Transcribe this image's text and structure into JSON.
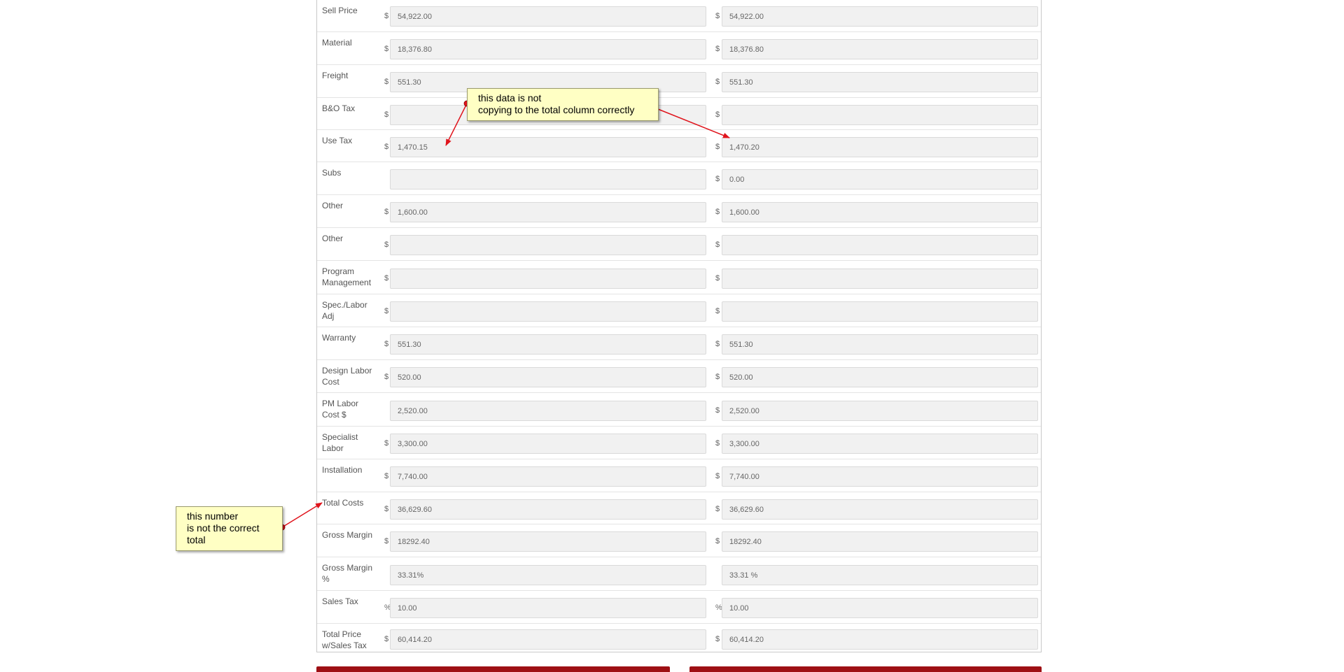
{
  "rows": [
    {
      "label": "Sell Price",
      "cur_a": "$",
      "val_a": "54,922.00",
      "cur_b": "$",
      "val_b": "54,922.00"
    },
    {
      "label": "Material",
      "cur_a": "$",
      "val_a": "18,376.80",
      "cur_b": "$",
      "val_b": "18,376.80"
    },
    {
      "label": "Freight",
      "cur_a": "$",
      "val_a": "551.30",
      "cur_b": "$",
      "val_b": "551.30"
    },
    {
      "label": "B&O Tax",
      "cur_a": "$",
      "val_a": "",
      "cur_b": "$",
      "val_b": ""
    },
    {
      "label": "Use Tax",
      "cur_a": "$",
      "val_a": "1,470.15",
      "cur_b": "$",
      "val_b": "1,470.20"
    },
    {
      "label": "Subs",
      "cur_a": "",
      "val_a": "",
      "cur_b": "$",
      "val_b": "0.00"
    },
    {
      "label": "Other",
      "cur_a": "$",
      "val_a": "1,600.00",
      "cur_b": "$",
      "val_b": "1,600.00"
    },
    {
      "label": "Other",
      "cur_a": "$",
      "val_a": "",
      "cur_b": "$",
      "val_b": ""
    },
    {
      "label": "Program Management",
      "cur_a": "$",
      "val_a": "",
      "cur_b": "$",
      "val_b": ""
    },
    {
      "label": "Spec./Labor Adj",
      "cur_a": "$",
      "val_a": "",
      "cur_b": "$",
      "val_b": ""
    },
    {
      "label": "Warranty",
      "cur_a": "$",
      "val_a": "551.30",
      "cur_b": "$",
      "val_b": "551.30"
    },
    {
      "label": "Design Labor Cost",
      "cur_a": "$",
      "val_a": "520.00",
      "cur_b": "$",
      "val_b": "520.00"
    },
    {
      "label": "PM Labor Cost $",
      "cur_a": "",
      "val_a": "2,520.00",
      "cur_b": "$",
      "val_b": "2,520.00"
    },
    {
      "label": "Specialist Labor",
      "cur_a": "$",
      "val_a": "3,300.00",
      "cur_b": "$",
      "val_b": "3,300.00"
    },
    {
      "label": "Installation",
      "cur_a": "$",
      "val_a": "7,740.00",
      "cur_b": "$",
      "val_b": "7,740.00"
    },
    {
      "label": "Total Costs",
      "cur_a": "$",
      "val_a": "36,629.60",
      "cur_b": "$",
      "val_b": "36,629.60"
    },
    {
      "label": "Gross Margin",
      "cur_a": "$",
      "val_a": "18292.40",
      "cur_b": "$",
      "val_b": "18292.40"
    },
    {
      "label": "Gross Margin %",
      "cur_a": "",
      "val_a": "33.31%",
      "cur_b": "",
      "val_b": "33.31 %"
    },
    {
      "label": "Sales Tax",
      "cur_a": "%",
      "val_a": "10.00",
      "cur_b": "%",
      "val_b": "10.00"
    },
    {
      "label": "Total Price w/Sales Tax",
      "cur_a": "$",
      "val_a": "60,414.20",
      "cur_b": "$",
      "val_b": "60,414.20"
    }
  ],
  "callouts": {
    "top": {
      "line1": "this data is not",
      "line2": "copying to the total column correctly"
    },
    "left": {
      "line1": "this number",
      "line2": "is not the correct",
      "line3": "total"
    }
  },
  "colors": {
    "callout_bg": "#ffffc4",
    "arrow": "#e0141c",
    "button": "#9e0f14"
  }
}
